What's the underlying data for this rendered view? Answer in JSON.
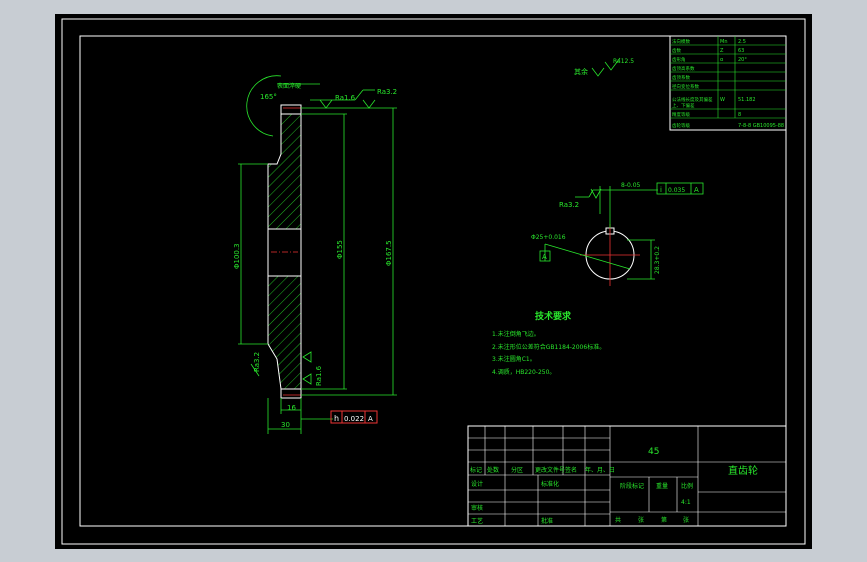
{
  "drawing_title": "直齿轮",
  "material": "45",
  "scale_value": "4:1",
  "roughness_rest": "其余",
  "roughness_rest_value": "Ra12.5",
  "parameters": [
    {
      "name": "法向模数",
      "symbol": "Mn",
      "value": "2.5"
    },
    {
      "name": "齿数",
      "symbol": "Z",
      "value": "63"
    },
    {
      "name": "齿形角",
      "symbol": "α",
      "value": "20°"
    },
    {
      "name": "齿顶高系数",
      "symbol": "",
      "value": ""
    },
    {
      "name": "齿顶系数",
      "symbol": "",
      "value": ""
    },
    {
      "name": "径向变位系数",
      "symbol": "",
      "value": ""
    },
    {
      "name": "公法线长度及其偏差",
      "symbol": "W",
      "value": "51.182"
    },
    {
      "name": "上、下偏差",
      "symbol": "",
      "value": ""
    },
    {
      "name": "精度等级",
      "symbol": "",
      "value": "8"
    },
    {
      "name": "齿轮等级",
      "symbol": "",
      "value": "7-8-8 GB10095-88"
    }
  ],
  "tech_req": {
    "title": "技术要求",
    "items": [
      "1.未注倒角飞边。",
      "2.未注形位公差符合GB1184-2006标准。",
      "3.未注圆角C1。",
      "4.调质，HB220-250。"
    ]
  },
  "dims": {
    "angle": "165°",
    "top_note": "表面淬硬",
    "ra16a": "Ra1.6",
    "ra32a": "Ra3.2",
    "d1": "Φ100.3",
    "d2": "Φ155",
    "d3": "Φ167.5",
    "ra32b": "Ra3.2",
    "ra16b": "Ra1.6",
    "w16": "16",
    "w30": "30",
    "ra32c": "Ra3.2",
    "bore": "Φ25+0.016",
    "datum": "A",
    "keyw": "8-0.05",
    "keyh": "28.3+0.2",
    "sym_tol_sym": "i",
    "sym_tol_val": "0.035",
    "sym_tol_ref": "A",
    "run_tol_sym": "h",
    "run_tol_val": "0.022",
    "run_tol_ref": "A"
  },
  "title_block": {
    "labels": [
      "标记",
      "处数",
      "分区",
      "更改文件号",
      "签名",
      "年、月、日"
    ],
    "left_labels": [
      "设计",
      "审核",
      "工艺"
    ],
    "standard": "标准化",
    "approve": "批准",
    "stage_mark": "阶段标记",
    "weight": "重量",
    "ratio": "比例",
    "sheet": [
      "共",
      "张",
      "第",
      "张"
    ]
  },
  "colors": {
    "line": "#29e62c",
    "white": "#ffffff",
    "red": "#e33",
    "bg": "#000000",
    "frame": "#c8cdd3"
  }
}
